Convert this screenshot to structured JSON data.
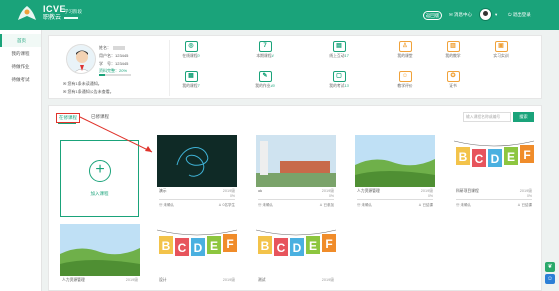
{
  "header": {
    "brand_en": "ICVE",
    "brand_cn": "职教云",
    "subtitle": "学习阶段",
    "btn_label": "返回版",
    "msg_label": "消息中心",
    "arrow": "▾",
    "logout": "退出登录"
  },
  "sidebar": {
    "items": [
      {
        "label": "首页"
      },
      {
        "label": "我的课程"
      },
      {
        "label": "待做作业"
      },
      {
        "label": "待做考试"
      }
    ]
  },
  "profile": {
    "name_label": "姓名：",
    "account_label": "用户名：123445",
    "id_label": "学　号：123445",
    "progress_label": "资料完整：20%",
    "progress": 0.2,
    "notice1": "您有1条未读通知。",
    "notice2": "您有1条通知公告未查看。"
  },
  "features": [
    {
      "icon": "fingerprint-icon",
      "label": "在线课程",
      "count": "0"
    },
    {
      "icon": "number-seven-icon",
      "label": "本期课程",
      "count": "4"
    },
    {
      "icon": "chart-icon",
      "label": "线上互动",
      "count": "17"
    },
    {
      "icon": "teacher-icon",
      "label": "我的课堂",
      "count": ""
    },
    {
      "icon": "bar-chart-icon",
      "label": "我的教学",
      "count": ""
    },
    {
      "icon": "briefcase-icon",
      "label": "实习实训",
      "count": ""
    },
    {
      "icon": "book-icon",
      "label": "我的课程",
      "count": "7"
    },
    {
      "icon": "edit-icon",
      "label": "我的作业",
      "count": "40"
    },
    {
      "icon": "document-icon",
      "label": "我的考试",
      "count": "13"
    },
    {
      "icon": "evaluate-icon",
      "label": "教学评价",
      "count": ""
    },
    {
      "icon": "medal-icon",
      "label": "证书",
      "count": ""
    }
  ],
  "courses_panel": {
    "tab_active": "在修课程",
    "tab_other": "已修课程",
    "search_placeholder": "输入课程名称或编号",
    "search_btn": "搜索",
    "add_label": "加入课程"
  },
  "courses": [
    {
      "name": "演示",
      "year": "2019级",
      "pct": "0%",
      "teacher": "未确认",
      "students": "0名学生",
      "thumb": "dark"
    },
    {
      "name": "ok",
      "year": "2019级",
      "pct": "0%",
      "teacher": "未确认",
      "students": "已参加",
      "thumb": "building"
    },
    {
      "name": "人力资源管理",
      "year": "2019级",
      "pct": "0%",
      "teacher": "未确认",
      "students": "已结课",
      "thumb": "field"
    },
    {
      "name": "科研项目课程",
      "year": "2019级",
      "pct": "0%",
      "teacher": "未确认",
      "students": "已结课",
      "thumb": "abc"
    },
    {
      "name": "人力资源管理",
      "year": "2019级",
      "pct": "",
      "teacher": "",
      "students": "",
      "thumb": "field"
    },
    {
      "name": "设计",
      "year": "2019级",
      "pct": "",
      "teacher": "",
      "students": "",
      "thumb": "abc"
    },
    {
      "name": "测试",
      "year": "2019级",
      "pct": "",
      "teacher": "",
      "students": "",
      "thumb": "abc"
    }
  ]
}
